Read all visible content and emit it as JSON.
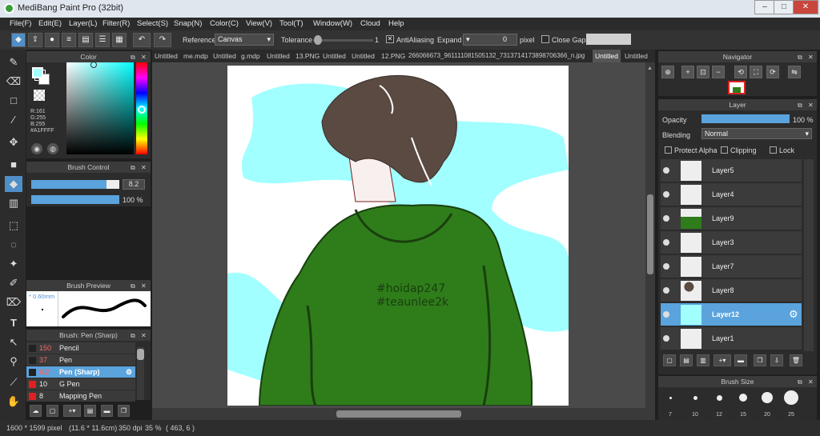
{
  "window": {
    "title": "MediBang Paint Pro (32bit)",
    "minimize": "–",
    "maximize": "□",
    "close": "✕"
  },
  "menu": [
    "File(F)",
    "Edit(E)",
    "Layer(L)",
    "Filter(R)",
    "Select(S)",
    "Snap(N)",
    "Color(C)",
    "View(V)",
    "Tool(T)",
    "Window(W)",
    "Cloud",
    "Help"
  ],
  "toolbar": {
    "reference_label": "Reference",
    "reference_value": "Canvas",
    "tolerance_label": "Tolerance",
    "tolerance_value": "1",
    "antialiasing_label": "AntiAliasing",
    "antialiasing_checked": true,
    "expand_label": "Expand",
    "expand_value": "0",
    "expand_unit": "pixel",
    "closegaps_label": "Close Gaps",
    "closegaps_checked": false
  },
  "color_panel": {
    "title": "Color",
    "r": "R:161",
    "g": "G:255",
    "b": "B:255",
    "hex": "#A1FFFF",
    "primary_color": "#a1ffff",
    "secondary_color": "#ffffff"
  },
  "brush_control": {
    "title": "Brush Control",
    "size": "8.2",
    "opacity": "100 %",
    "size_fraction": 0.85,
    "opacity_fraction": 1.0
  },
  "brush_preview": {
    "title": "Brush Preview",
    "size_label": "* 0.60mm"
  },
  "brush_list": {
    "title": "Brush: Pen (Sharp)",
    "items": [
      {
        "size": "150",
        "name": "Pencil",
        "color": "#222222",
        "selected": false
      },
      {
        "size": "37",
        "name": "Pen",
        "color": "#222222",
        "selected": false
      },
      {
        "size": "8.2",
        "name": "Pen (Sharp)",
        "color": "#222222",
        "selected": true
      },
      {
        "size": "10",
        "name": "G Pen",
        "color": "#e02020",
        "selected": false
      },
      {
        "size": "8",
        "name": "Mapping Pen",
        "color": "#e02020",
        "selected": false
      }
    ]
  },
  "tabs": [
    "Untitled",
    "me.mdp",
    "Untitled",
    "g.mdp",
    "Untitled",
    "13.PNG",
    "Untitled",
    "Untitled",
    "12.PNG",
    "266066673_961111081505132_7313714173898706366_n.jpg",
    "Untitled",
    "Untitled"
  ],
  "active_tab": 10,
  "canvas_text": {
    "line1": "#hoidap247",
    "line2": "#teaunlee2k"
  },
  "navigator": {
    "title": "Navigator"
  },
  "layer_panel": {
    "title": "Layer",
    "opacity_label": "Opacity",
    "opacity_value": "100 %",
    "blending_label": "Blending",
    "blending_value": "Normal",
    "protect_alpha": "Protect Alpha",
    "clipping": "Clipping",
    "lock": "Lock",
    "layers": [
      {
        "name": "Layer5",
        "selected": false
      },
      {
        "name": "Layer4",
        "selected": false
      },
      {
        "name": "Layer9",
        "selected": false
      },
      {
        "name": "Layer3",
        "selected": false
      },
      {
        "name": "Layer7",
        "selected": false
      },
      {
        "name": "Layer8",
        "selected": false
      },
      {
        "name": "Layer12",
        "selected": true
      },
      {
        "name": "Layer1",
        "selected": false
      }
    ]
  },
  "brush_size": {
    "title": "Brush Size",
    "sizes": [
      "7",
      "10",
      "12",
      "15",
      "20",
      "25"
    ]
  },
  "status": {
    "dims": "1600 * 1599 pixel",
    "cm": "(11.6 * 11.6cm)",
    "dpi": "350 dpi",
    "zoom": "35 %",
    "coords": "( 463, 6 )"
  },
  "colors": {
    "accent": "#5ba3dc",
    "shirt": "#2e7d1a",
    "sky": "#a1ffff",
    "hair": "#5a4a42"
  }
}
